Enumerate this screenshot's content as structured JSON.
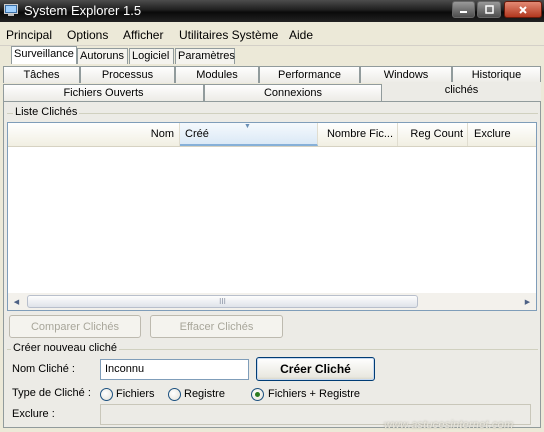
{
  "window": {
    "title": "System Explorer 1.5"
  },
  "menu": {
    "items": [
      "Principal",
      "Options",
      "Afficher",
      "Utilitaires Système",
      "Aide"
    ]
  },
  "top_tabs": {
    "items": [
      "Surveillance",
      "Autoruns",
      "Logiciel",
      "Paramètres"
    ],
    "active": "Surveillance"
  },
  "sub_tabs": {
    "row1": [
      "Tâches",
      "Processus",
      "Modules",
      "Performance",
      "Windows",
      "Historique"
    ],
    "row2": [
      "Fichiers Ouverts",
      "Connexions",
      "clichés"
    ],
    "selected": "clichés"
  },
  "list": {
    "group_label": "Liste Clichés",
    "columns": [
      "Nom",
      "Créé",
      "Nombre Fic...",
      "Reg Count",
      "Exclure"
    ],
    "sorted_column": "Créé",
    "rows": [],
    "scroll_grip": "III"
  },
  "actions": {
    "compare": "Comparer Clichés",
    "clear": "Effacer Clichés"
  },
  "create": {
    "group_label": "Créer nouveau cliché",
    "name_label": "Nom Cliché :",
    "name_value": "Inconnu",
    "create_button": "Créer Cliché",
    "type_label": "Type de Cliché :",
    "type_options": [
      "Fichiers",
      "Registre",
      "Fichiers + Registre"
    ],
    "selected_type": "Fichiers + Registre",
    "exclude_label": "Exclure :",
    "exclude_value": ""
  },
  "watermark": "www.astucesinternet.com",
  "colors": {
    "title_bar": "#1f1f1f",
    "close_button": "#c4472b",
    "list_border": "#7f9db9",
    "radio_selected": "#2a7a1f"
  }
}
